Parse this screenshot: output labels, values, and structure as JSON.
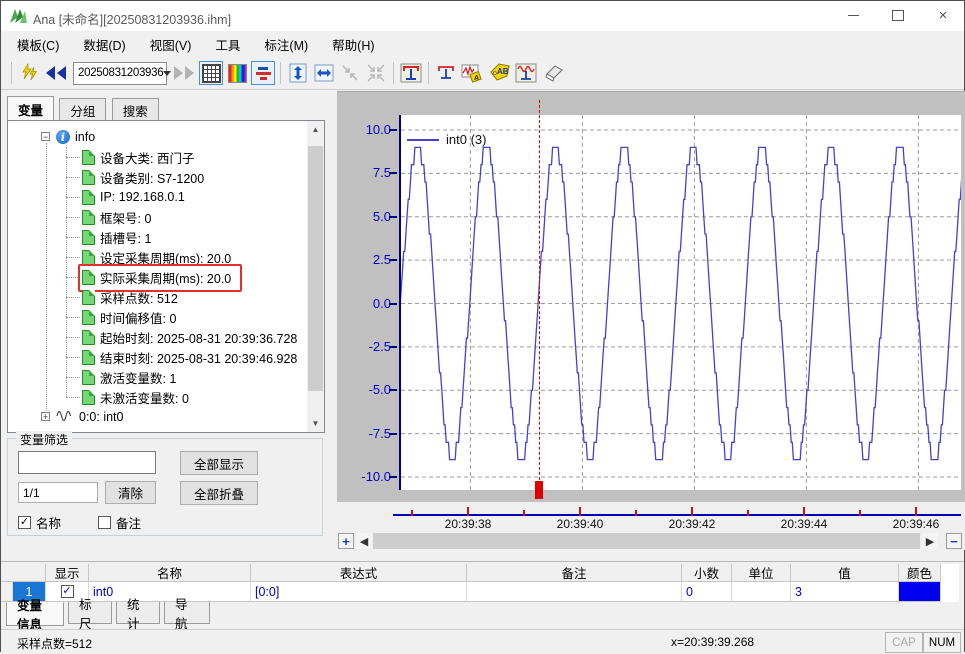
{
  "window": {
    "title": "Ana  [未命名][20250831203936.ihm]",
    "controls": {
      "minimize": "minimize",
      "maximize": "maximize",
      "close": "close"
    }
  },
  "menu": {
    "items": [
      "模板(C)",
      "数据(D)",
      "视图(V)",
      "工具",
      "标注(M)",
      "帮助(H)"
    ]
  },
  "toolbar": {
    "dataset_value": "20250831203936",
    "icons": [
      "refresh-icon",
      "prev-dataset-icon",
      "next-dataset-icon",
      "grid-toggle-icon",
      "colormap-icon",
      "curve-style-icon",
      "fit-vertical-icon",
      "fit-horizontal-icon",
      "zoom-restore-icon",
      "zoom-collapse-icon",
      "add-ruler-icon",
      "small-ruler-icon",
      "annotate-a-icon",
      "annotate-ab-icon",
      "ruler-wave-icon",
      "eraser-icon"
    ]
  },
  "sidebar": {
    "tabs": [
      "变量",
      "分组",
      "搜索"
    ],
    "active_tab": "变量",
    "tree": {
      "root_label": "info",
      "children": [
        {
          "label": "设备大类: 西门子"
        },
        {
          "label": "设备类别: S7-1200"
        },
        {
          "label": "IP: 192.168.0.1"
        },
        {
          "label": "框架号: 0"
        },
        {
          "label": "插槽号: 1"
        },
        {
          "label": "设定采集周期(ms): 20.0"
        },
        {
          "label": "实际采集周期(ms): 20.0",
          "highlighted": true
        },
        {
          "label": "采样点数: 512"
        },
        {
          "label": "时间偏移值: 0"
        },
        {
          "label": "起始时刻: 2025-08-31 20:39:36.728"
        },
        {
          "label": "结束时刻: 2025-08-31 20:39:46.928"
        },
        {
          "label": "激活变量数: 1"
        },
        {
          "label": "未激活变量数: 0"
        }
      ],
      "collapsed_node": "0:0: int0"
    },
    "filter": {
      "legend": "变量筛选",
      "input_value": "",
      "count_value": "1/1",
      "show_all_label": "全部显示",
      "clear_label": "清除",
      "collapse_all_label": "全部折叠",
      "checkboxes": [
        {
          "label": "名称",
          "checked": true
        },
        {
          "label": "备注",
          "checked": false
        }
      ]
    }
  },
  "chart_data": {
    "type": "line",
    "title": "",
    "legend": {
      "entries": [
        "int0 (3)"
      ],
      "position": "top-left"
    },
    "series": [
      {
        "name": "int0 (3)",
        "color": "#4242cd",
        "waveform": {
          "shape": "quantized_sine",
          "amplitude": 9,
          "offset": 0,
          "quantize_step": 1,
          "period_s": 1.23,
          "peak_time_s": 39.519,
          "sample_interval_s": 0.02,
          "start_time_s": 36.728,
          "end_time_s": 46.928
        }
      }
    ],
    "x_axis": {
      "kind": "time",
      "seconds_after": "20:39:00",
      "window_start_s": 36.76,
      "window_end_s": 46.76,
      "major_ticks": [
        {
          "time_s": 38,
          "label": "20:39:38"
        },
        {
          "time_s": 40,
          "label": "20:39:40"
        },
        {
          "time_s": 42,
          "label": "20:39:42"
        },
        {
          "time_s": 44,
          "label": "20:39:44"
        },
        {
          "time_s": 46,
          "label": "20:39:46"
        }
      ],
      "minor_ticks_s": [
        37,
        39,
        41,
        43,
        45
      ]
    },
    "y_axis": {
      "min": -10,
      "max": 10,
      "tick_step": 2.5,
      "tick_labels": [
        "10.0",
        "7.5",
        "5.0",
        "2.5",
        "0.0",
        "-2.5",
        "-5.0",
        "-7.5",
        "-10.0"
      ]
    },
    "grid": true,
    "cursor": {
      "time_s": 39.268,
      "value": 3,
      "color": "#e00000"
    }
  },
  "table": {
    "headers": [
      "",
      "显示",
      "名称",
      "表达式",
      "备注",
      "小数",
      "单位",
      "值",
      "颜色"
    ],
    "row": {
      "index": "1",
      "visible_checked": true,
      "name": "int0",
      "expression": "[0:0]",
      "comment": "",
      "decimals": "0",
      "unit": "",
      "value": "3",
      "color": "#0000ee"
    }
  },
  "bottom_tabs": {
    "items": [
      "变量信息",
      "标尺",
      "统计",
      "导航"
    ],
    "active": "变量信息"
  },
  "status": {
    "samples": "采样点数=512",
    "cursor_x": "x=20:39:39.268",
    "cap": "CAP",
    "num": "NUM"
  }
}
